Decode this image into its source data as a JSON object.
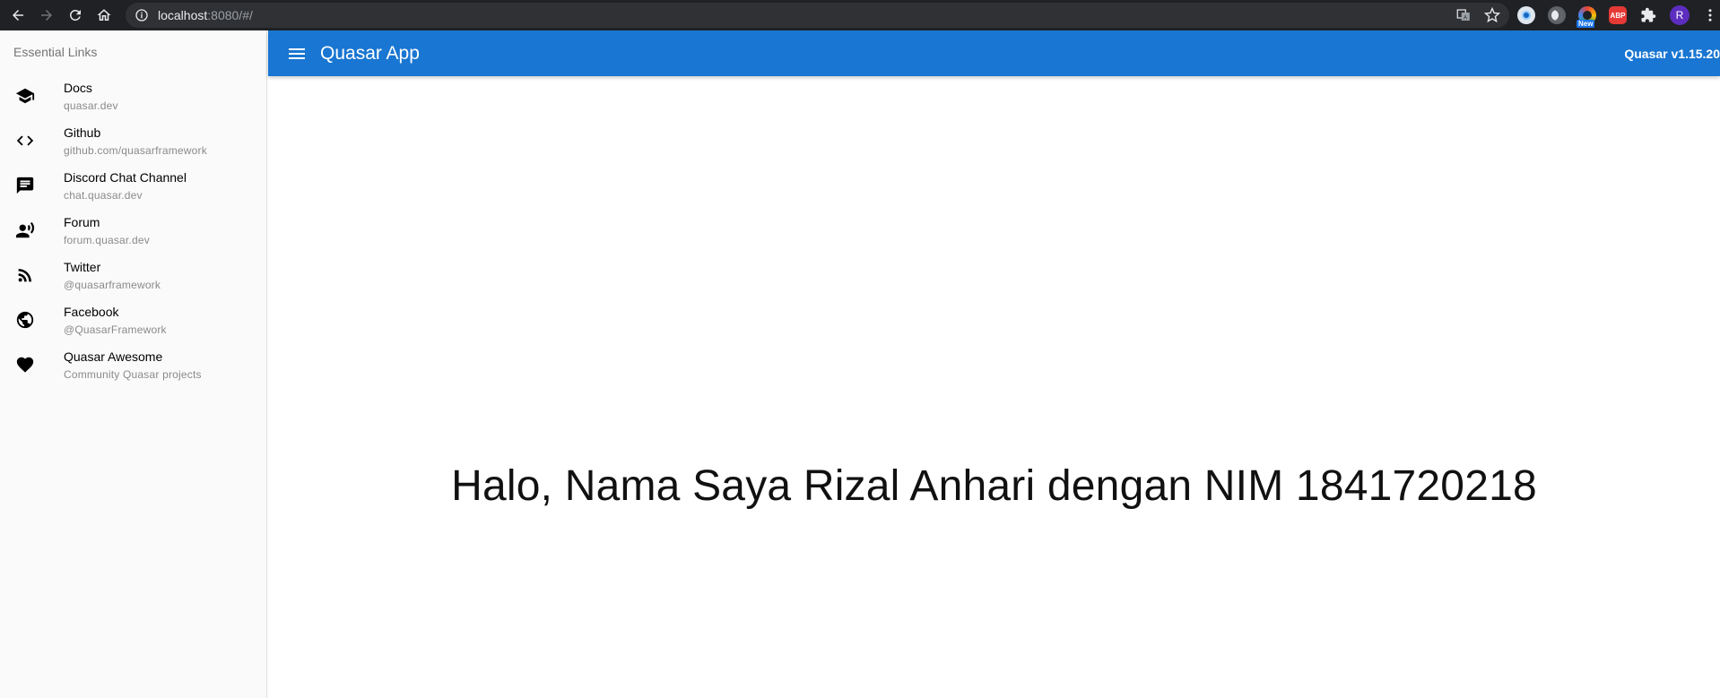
{
  "browser": {
    "url_host": "localhost",
    "url_rest": ":8080/#/",
    "extensions": [
      {
        "name": "circle-extension",
        "color": "#8ab4f8",
        "label": ""
      },
      {
        "name": "moon-extension",
        "color": "#9aa0a6",
        "label": ""
      },
      {
        "name": "rainbow-extension",
        "color": "#f4b400",
        "label": "",
        "badge": "New"
      },
      {
        "name": "abp-extension",
        "color": "#e53935",
        "label": "ABP"
      }
    ],
    "profile_initial": "R"
  },
  "sidebar": {
    "header": "Essential Links",
    "items": [
      {
        "title": "Docs",
        "caption": "quasar.dev",
        "icon": "school-icon"
      },
      {
        "title": "Github",
        "caption": "github.com/quasarframework",
        "icon": "code-icon"
      },
      {
        "title": "Discord Chat Channel",
        "caption": "chat.quasar.dev",
        "icon": "chat-icon"
      },
      {
        "title": "Forum",
        "caption": "forum.quasar.dev",
        "icon": "record-voice-icon"
      },
      {
        "title": "Twitter",
        "caption": "@quasarframework",
        "icon": "rss-feed-icon"
      },
      {
        "title": "Facebook",
        "caption": "@QuasarFramework",
        "icon": "public-icon"
      },
      {
        "title": "Quasar Awesome",
        "caption": "Community Quasar projects",
        "icon": "favorite-icon"
      }
    ]
  },
  "header": {
    "title": "Quasar App",
    "version": "Quasar v1.15.20",
    "color": "#1976d2"
  },
  "main": {
    "greeting": "Halo, Nama Saya Rizal Anhari dengan NIM 1841720218"
  }
}
